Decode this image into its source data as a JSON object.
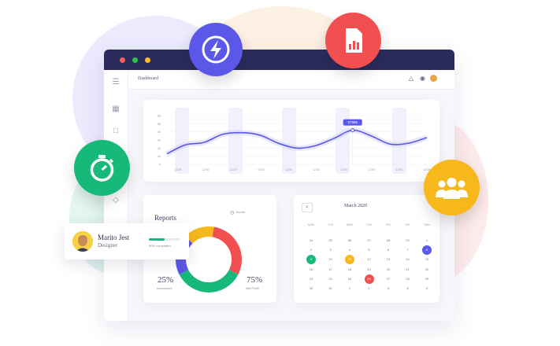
{
  "topbar": {
    "title": "Dashboard"
  },
  "chart_data": {
    "type": "line",
    "y_ticks": [
      "6k",
      "5k",
      "4k",
      "3k",
      "2k",
      "1k",
      "0"
    ],
    "x_ticks": [
      "12:00",
      "12:00",
      "12:00",
      "12:00",
      "12:00",
      "12:00",
      "12:00",
      "12:00",
      "12:00",
      "12:00"
    ],
    "series": [
      {
        "values": [
          1.3,
          2.4,
          2.7,
          3.7,
          3.9,
          3.6,
          2.6,
          2.0,
          2.3,
          3.2,
          4.2,
          3.5,
          2.5,
          2.6,
          3.3
        ]
      }
    ],
    "tooltip": "57986",
    "ylim": [
      0,
      6
    ]
  },
  "reports": {
    "title": "Reports",
    "period": "Month",
    "left_pct": "25%",
    "left_label": "Investment",
    "right_pct": "75%",
    "right_label": "Net Profit",
    "donut": [
      {
        "value": 30,
        "color": "#f25050"
      },
      {
        "value": 35,
        "color": "#17b97a"
      },
      {
        "value": 20,
        "color": "#5b57e8"
      },
      {
        "value": 15,
        "color": "#f7b81c"
      }
    ]
  },
  "calendar": {
    "title": "March 2020",
    "prev": "<",
    "headers": [
      "MON",
      "TUE",
      "WED",
      "THU",
      "FRI",
      "SAT",
      "SUN"
    ],
    "rows": [
      [
        "24",
        "25",
        "26",
        "27",
        "28",
        "29",
        "1"
      ],
      [
        "2",
        "3",
        "4",
        "5",
        "6",
        "7",
        "8"
      ],
      [
        "9",
        "10",
        "11",
        "12",
        "13",
        "14",
        "15"
      ],
      [
        "16",
        "17",
        "18",
        "19",
        "20",
        "21",
        "22"
      ],
      [
        "23",
        "24",
        "25",
        "26",
        "27",
        "28",
        "29"
      ],
      [
        "30",
        "31",
        "1",
        "2",
        "3",
        "4",
        "5"
      ]
    ],
    "highlights": {
      "1-6": "#5b57e8",
      "2-0": "#17b97a",
      "2-2": "#f7b81c",
      "4-3": "#f25050"
    }
  },
  "profile": {
    "name": "Marito Jest",
    "role": "Designer",
    "progress_label": "50% completed",
    "progress": 0.5
  },
  "icons": {
    "bolt": "lightning-icon",
    "report": "report-document-icon",
    "timer": "stopwatch-icon",
    "team": "team-users-icon"
  }
}
